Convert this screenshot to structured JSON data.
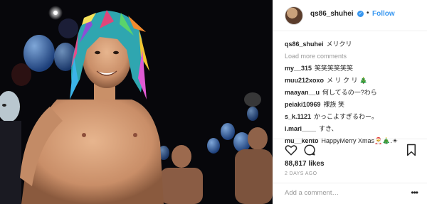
{
  "post": {
    "username": "qs86_shuhei",
    "verified_badge": "✓",
    "separator": "•",
    "follow_label": "Follow",
    "caption_user": "qs86_shuhei",
    "caption_text": "メリクリ",
    "load_more": "Load more comments",
    "comments": [
      {
        "user": "my__315",
        "text": "笑笑笑笑笑笑"
      },
      {
        "user": "muu212xoxo",
        "text": "メ リ ク リ 🎄"
      },
      {
        "user": "maayan__u",
        "text": "何してるの一?わら"
      },
      {
        "user": "peiaki10969",
        "text": "裸族 笑"
      },
      {
        "user": "s_k.1121",
        "text": "かっこよすぎるわー。"
      },
      {
        "user": "i.mari____",
        "text": "すき、"
      },
      {
        "user": "mu__kento",
        "text": "HappyMerry Xmas🎅🎄.☀"
      }
    ],
    "likes": "88,817 likes",
    "time_ago": "2 DAYS AGO",
    "add_comment_placeholder": "Add a comment…",
    "more_options": "•••"
  },
  "icons": {
    "heart": "heart-icon",
    "comment": "comment-icon",
    "save": "bookmark-icon"
  },
  "colors": {
    "link_blue": "#3897f0",
    "text": "#262626",
    "muted": "#999999"
  }
}
